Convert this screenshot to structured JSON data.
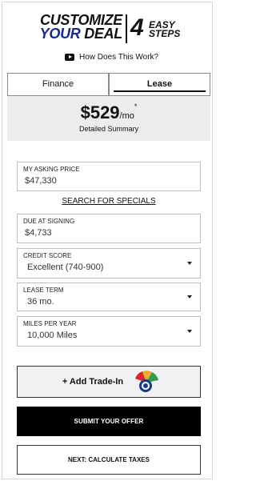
{
  "header": {
    "line1": "CUSTOMIZE",
    "line2_accent": "YOUR",
    "line2_rest": "DEAL",
    "steps_number": "4",
    "steps_word1": "EASY",
    "steps_word2": "STEPS",
    "how_link": "How Does This Work?"
  },
  "tabs": [
    {
      "label": "Finance",
      "active": false
    },
    {
      "label": "Lease",
      "active": true
    }
  ],
  "summary": {
    "price": "$529",
    "unit": "/mo",
    "asterisk": "*",
    "detail_link": "Detailed Summary"
  },
  "fields": {
    "asking_price": {
      "label": "MY ASKING PRICE",
      "value": "$47,330"
    },
    "specials_link": "SEARCH FOR SPECIALS",
    "due_at_signing": {
      "label": "DUE AT SIGNING",
      "value": "$4,733"
    },
    "credit_score": {
      "label": "CREDIT SCORE",
      "value": "Excellent (740-900)"
    },
    "lease_term": {
      "label": "LEASE TERM",
      "value": "36 mo."
    },
    "miles_per_year": {
      "label": "MILES PER YEAR",
      "value": "10,000 Miles"
    }
  },
  "actions": {
    "trade_in": "+ Add Trade-In",
    "submit": "SUBMIT YOUR OFFER",
    "next": "NEXT: CALCULATE TAXES"
  },
  "colors": {
    "accent_blue": "#1a2a8c",
    "panel_gray": "#ececec",
    "submit_bg": "#000000"
  }
}
